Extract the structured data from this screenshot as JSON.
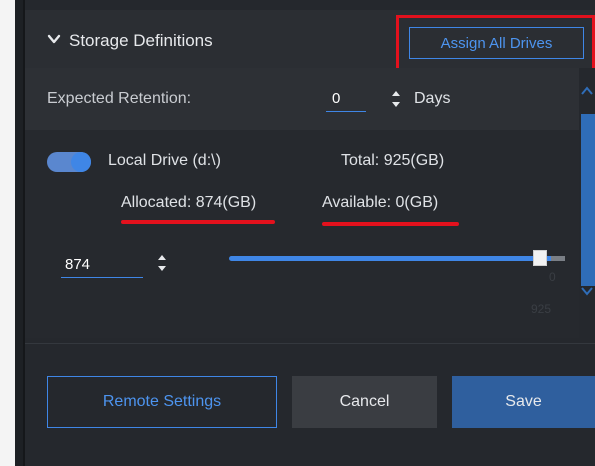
{
  "header": {
    "title": "Storage Definitions",
    "assign_all_label": "Assign All Drives"
  },
  "retention": {
    "label": "Expected Retention:",
    "value": "0",
    "unit": "Days"
  },
  "drive": {
    "enabled": true,
    "name": "Local Drive (d:\\)",
    "total": "Total: 925(GB)",
    "allocated": "Allocated: 874(GB)",
    "available": "Available: 0(GB)",
    "allocation_value": "874",
    "slider_fraction": 0.945,
    "slider_max_faint": "925",
    "slider_zero_faint": "0"
  },
  "footer": {
    "remote_label": "Remote Settings",
    "cancel_label": "Cancel",
    "save_label": "Save"
  },
  "colors": {
    "accent": "#3f86e6",
    "highlight": "#e3111d",
    "panel": "#25282d"
  }
}
